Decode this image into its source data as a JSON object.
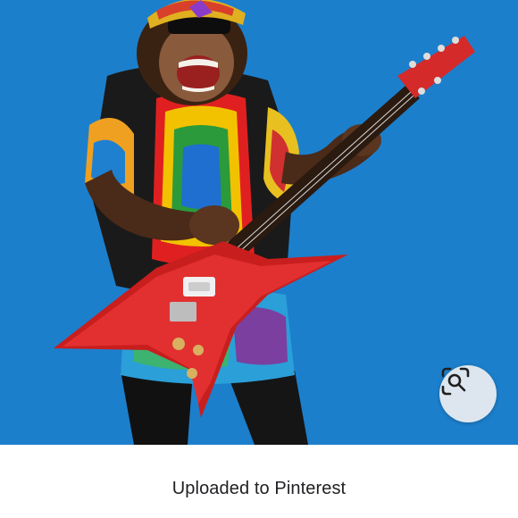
{
  "image": {
    "subject_icon": "chimpanzee-guitarist-photo",
    "background_color": "#1c7fcc"
  },
  "lens": {
    "icon": "visual-search-icon",
    "background_color": "#dde6ee"
  },
  "caption": {
    "title": "Uploaded to Pinterest"
  }
}
